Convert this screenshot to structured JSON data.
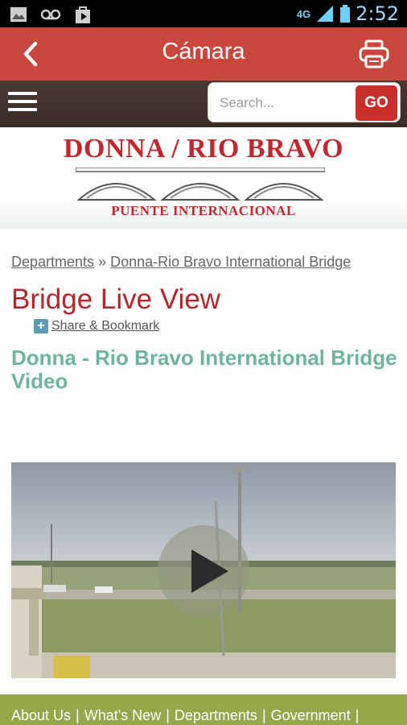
{
  "status_bar": {
    "network": "4G",
    "time": "2:52",
    "icons": [
      "image-icon",
      "voicemail-icon",
      "shopping-bag-icon",
      "signal-icon",
      "battery-icon"
    ]
  },
  "app_bar": {
    "title": "Cámara",
    "back_icon": "chevron-left-icon",
    "print_icon": "printer-icon",
    "color": "#c9473c"
  },
  "nav_bar": {
    "menu_icon": "hamburger-icon",
    "search": {
      "placeholder": "Search...",
      "value": "",
      "go_label": "GO"
    }
  },
  "banner": {
    "title": "DONNA / RIO BRAVO",
    "subtitle": "PUENTE INTERNACIONAL"
  },
  "breadcrumb": {
    "items": [
      "Departments",
      "Donna-Rio Bravo International Bridge"
    ],
    "separator": "»"
  },
  "page": {
    "title": "Bridge Live View",
    "share_label": "Share & Bookmark",
    "video_heading": "Donna - Rio Bravo International Bridge Video"
  },
  "video": {
    "play_icon": "play-icon"
  },
  "footer": {
    "links": [
      "About Us",
      "What's New",
      "Departments",
      "Government"
    ],
    "color": "#93a848"
  },
  "colors": {
    "accent_red": "#b2262c",
    "teal_heading": "#6fb3a1",
    "go_button": "#c9302c"
  }
}
